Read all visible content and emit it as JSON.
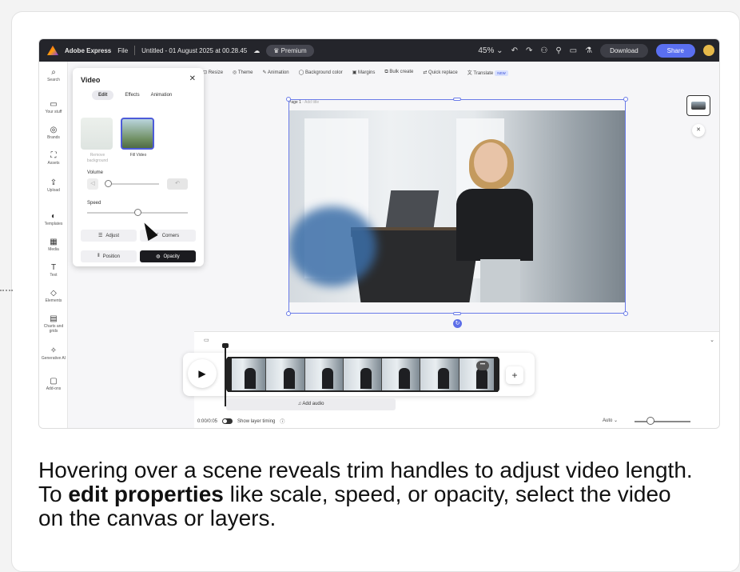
{
  "app": {
    "name": "Adobe Express",
    "file_menu": "File",
    "doc_title": "Untitled - 01 August 2025 at 00.28.45",
    "premium": "Premium",
    "zoom": "45%",
    "download": "Download",
    "share": "Share"
  },
  "rail": {
    "items": [
      {
        "icon": "⌕",
        "label": "Search"
      },
      {
        "icon": "▭",
        "label": "Your stuff"
      },
      {
        "icon": "◎",
        "label": "Brands"
      },
      {
        "icon": "⛶",
        "label": "Assets"
      },
      {
        "icon": "⇪",
        "label": "Upload"
      },
      {
        "icon": "◐",
        "label": "Templates"
      },
      {
        "icon": "▦",
        "label": "Media"
      },
      {
        "icon": "T",
        "label": "Text"
      },
      {
        "icon": "◇",
        "label": "Elements"
      },
      {
        "icon": "▤",
        "label": "Charts and grids"
      },
      {
        "icon": "✧",
        "label": "Generative AI"
      },
      {
        "icon": "▢",
        "label": "Add-ons"
      }
    ]
  },
  "toolbar": {
    "items": [
      "Resize",
      "Theme",
      "Animation",
      "Background color",
      "Margins",
      "Bulk create",
      "Quick replace",
      "Translate"
    ],
    "new_badge": "NEW"
  },
  "panel": {
    "title": "Video",
    "tabs": [
      "Edit",
      "Effects",
      "Animation"
    ],
    "thumb1_caption": "Remove background",
    "thumb2_caption": "Fill Video",
    "volume_label": "Volume",
    "volume_level": 0.0,
    "speed_label": "Speed",
    "speed_level": 0.5,
    "adjust": "Adjust",
    "corners": "Corners",
    "position": "Position",
    "opacity": "Opacity"
  },
  "canvas": {
    "page_label": "Page 1",
    "add_title": "- Add title"
  },
  "timeline": {
    "time": "0:00/0:05",
    "show_layer_timing": "Show layer timing",
    "add_audio": "Add audio",
    "auto": "Auto",
    "more": "•••",
    "plus": "+",
    "play": "▶"
  },
  "caption": {
    "part1": "Hovering over a scene reveals trim handles to adjust video length. To ",
    "bold": "edit properties",
    "part2": " like scale, speed, or opacity, select the video on the canvas or layers."
  },
  "colors": {
    "topbar": "#24252b",
    "accent": "#5a6ff0",
    "selection": "#6a7be8"
  }
}
